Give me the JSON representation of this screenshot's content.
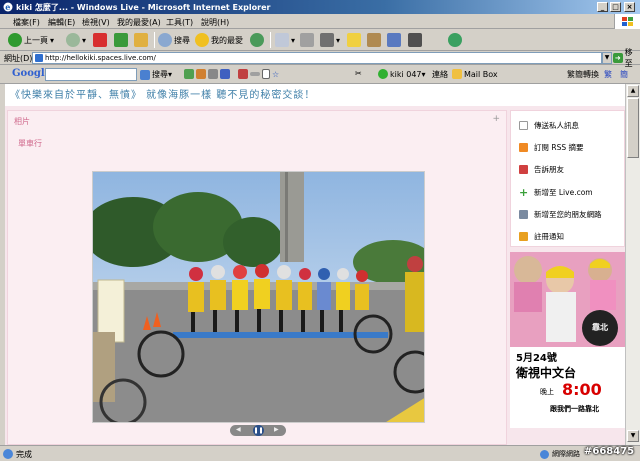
{
  "window": {
    "title": "kiki 怎麼了... - Windows Live - Microsoft Internet Explorer",
    "minimize": "_",
    "maximize": "□",
    "close": "×"
  },
  "menu": [
    "檔案(F)",
    "編輯(E)",
    "檢視(V)",
    "我的最愛(A)",
    "工具(T)",
    "說明(H)"
  ],
  "toolbar": {
    "back": "上一頁",
    "search": "搜尋",
    "favorites": "我的最愛"
  },
  "address": {
    "label": "網址(D)",
    "url": "http://hellokiki.spaces.live.com/",
    "go": "移至"
  },
  "google_bar": {
    "logo": "Google",
    "search": "搜尋",
    "user": "kiki 047",
    "contacts": "連絡",
    "mailbox": "Mail Box",
    "tools_label": "繁簡轉換",
    "trad": "繁",
    "simp": "簡"
  },
  "page": {
    "marquee": "《快樂來自於平靜、無憤》  就像海豚一樣  聽不見的秘密交談！",
    "photos_title": "相片",
    "album": "單車行",
    "plus": "+"
  },
  "sidebar": [
    {
      "label": "傳送私人訊息",
      "icon": "envelope-icon",
      "color": "#9a9a9a"
    },
    {
      "label": "訂閱 RSS 摘要",
      "icon": "rss-icon",
      "color": "#f08a24"
    },
    {
      "label": "告訴朋友",
      "icon": "tell-friend-icon",
      "color": "#d04040"
    },
    {
      "label": "新增至 Live.com",
      "icon": "add-icon",
      "color": "#3aa03a"
    },
    {
      "label": "新增至您的朋友網路",
      "icon": "network-icon",
      "color": "#7a8aa0"
    },
    {
      "label": "註冊通知",
      "icon": "alert-icon",
      "color": "#e8a020"
    }
  ],
  "ad": {
    "date": "5月24號",
    "station": "衛視中文台",
    "time_label": "晚上",
    "time": "8:00",
    "slogan": "跟我們一路靠北",
    "badge": "靠北"
  },
  "status": {
    "text": "完成",
    "zone": "網際網路"
  },
  "watermark": "#668475"
}
